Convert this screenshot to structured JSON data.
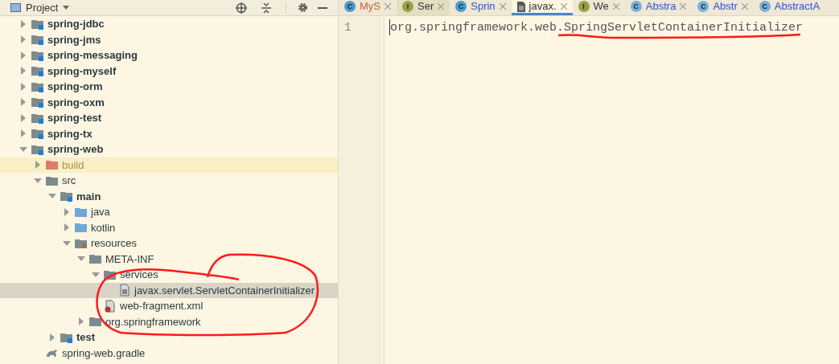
{
  "panel": {
    "title": "Project"
  },
  "tree": [
    {
      "label": "spring-jdbc",
      "kind": "module",
      "expanded": false,
      "selected": false
    },
    {
      "label": "spring-jms",
      "kind": "module",
      "expanded": false,
      "selected": false
    },
    {
      "label": "spring-messaging",
      "kind": "module",
      "expanded": false,
      "selected": false
    },
    {
      "label": "spring-myself",
      "kind": "module",
      "expanded": false,
      "selected": false
    },
    {
      "label": "spring-orm",
      "kind": "module",
      "expanded": false,
      "selected": false
    },
    {
      "label": "spring-oxm",
      "kind": "module",
      "expanded": false,
      "selected": false
    },
    {
      "label": "spring-test",
      "kind": "module",
      "expanded": false,
      "selected": false
    },
    {
      "label": "spring-tx",
      "kind": "module",
      "expanded": false,
      "selected": false
    },
    {
      "label": "spring-web",
      "kind": "module",
      "expanded": true,
      "selected": false,
      "children": [
        {
          "label": "build",
          "kind": "excluded",
          "expanded": false,
          "selected": false
        },
        {
          "label": "src",
          "kind": "folder",
          "expanded": true,
          "selected": false,
          "children": [
            {
              "label": "main",
              "kind": "module",
              "expanded": true,
              "selected": false,
              "children": [
                {
                  "label": "java",
                  "kind": "source",
                  "expanded": false,
                  "selected": false
                },
                {
                  "label": "kotlin",
                  "kind": "source",
                  "expanded": false,
                  "selected": false
                },
                {
                  "label": "resources",
                  "kind": "resources",
                  "expanded": true,
                  "selected": false,
                  "children": [
                    {
                      "label": "META-INF",
                      "kind": "folder",
                      "expanded": true,
                      "selected": false,
                      "children": [
                        {
                          "label": "services",
                          "kind": "folder",
                          "expanded": true,
                          "selected": false,
                          "children": [
                            {
                              "label": "javax.servlet.ServletContainerInitializer",
                              "kind": "file",
                              "selected": true
                            }
                          ]
                        },
                        {
                          "label": "web-fragment.xml",
                          "kind": "xml",
                          "selected": false
                        }
                      ]
                    },
                    {
                      "label": "org.springframework",
                      "kind": "folder",
                      "expanded": false,
                      "selected": false
                    }
                  ]
                }
              ]
            },
            {
              "label": "test",
              "kind": "module",
              "expanded": false,
              "selected": false
            }
          ]
        },
        {
          "label": "spring-web.gradle",
          "kind": "gradle",
          "selected": false
        }
      ]
    }
  ],
  "tabs": [
    {
      "label": "MyS",
      "badge": "C",
      "kind": "class",
      "color": "#c8643c",
      "selected": false
    },
    {
      "label": "Ser",
      "badge": "I",
      "kind": "interface-locked",
      "color": "#333333",
      "selected": false
    },
    {
      "label": "Sprin",
      "badge": "C",
      "kind": "class",
      "color": "#3050c8",
      "selected": false
    },
    {
      "label": "javax.",
      "kind": "file",
      "color": "#333333",
      "selected": true
    },
    {
      "label": "We",
      "badge": "I",
      "kind": "interface",
      "color": "#333333",
      "selected": false
    },
    {
      "label": "Abstra",
      "badge": "C",
      "kind": "abstract",
      "color": "#3050c8",
      "selected": false
    },
    {
      "label": "Abstr",
      "badge": "C",
      "kind": "abstract",
      "color": "#3050c8",
      "selected": false
    },
    {
      "label": "AbstractA",
      "badge": "C",
      "kind": "abstract",
      "color": "#3050c8",
      "selected": false
    }
  ],
  "editor": {
    "lines": [
      {
        "number": "1",
        "text": "org.springframework.web.SpringServletContainerInitializer"
      }
    ]
  }
}
